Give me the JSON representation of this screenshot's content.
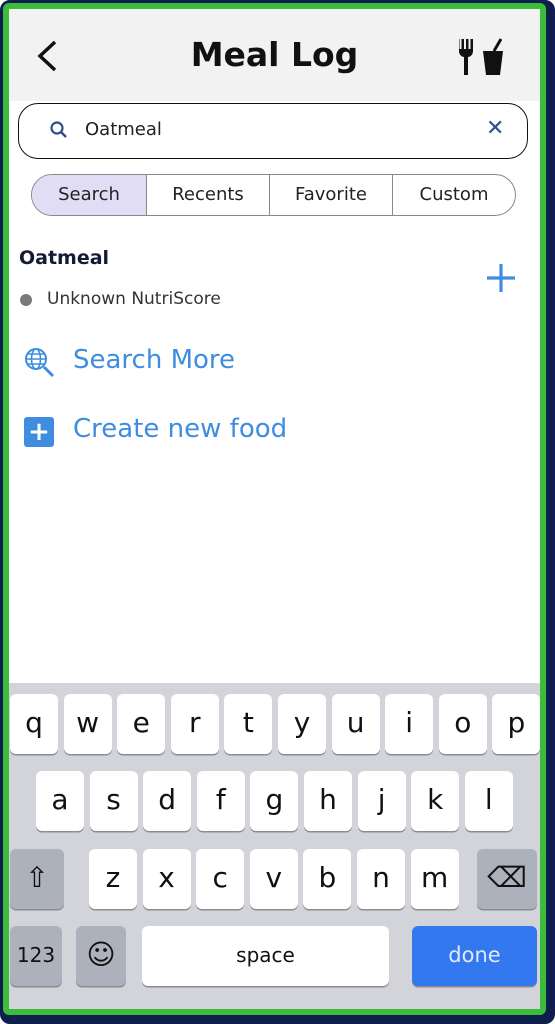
{
  "header": {
    "title": "Meal Log",
    "back_icon": "chevron-left-icon",
    "right_icon": "fork-and-drink-icon"
  },
  "search": {
    "value": "Oatmeal",
    "search_icon": "search-icon",
    "clear_icon": "close-icon"
  },
  "tabs": [
    {
      "label": "Search",
      "selected": true
    },
    {
      "label": "Recents"
    },
    {
      "label": "Favorite"
    },
    {
      "label": "Custom"
    }
  ],
  "results": [
    {
      "name": "Oatmeal",
      "nutriscore": "Unknown NutriScore",
      "add_icon": "plus-icon"
    }
  ],
  "actions": {
    "search_more": "Search More",
    "create_new": "Create new food"
  },
  "colors": {
    "accent": "#3f8de0",
    "frame_outer": "#0e1f4d",
    "frame_inner": "#3dbb3a",
    "done_key": "#3478f0",
    "selected_tab": "#e0ddf5"
  },
  "keyboard": {
    "row1": [
      "q",
      "w",
      "e",
      "r",
      "t",
      "y",
      "u",
      "i",
      "o",
      "p"
    ],
    "row2": [
      "a",
      "s",
      "d",
      "f",
      "g",
      "h",
      "j",
      "k",
      "l"
    ],
    "row3": [
      "z",
      "x",
      "c",
      "v",
      "b",
      "n",
      "m"
    ],
    "shift": "⇧",
    "delete": "⌫",
    "numbers": "123",
    "emoji": "☺",
    "space": "space",
    "done": "done"
  }
}
